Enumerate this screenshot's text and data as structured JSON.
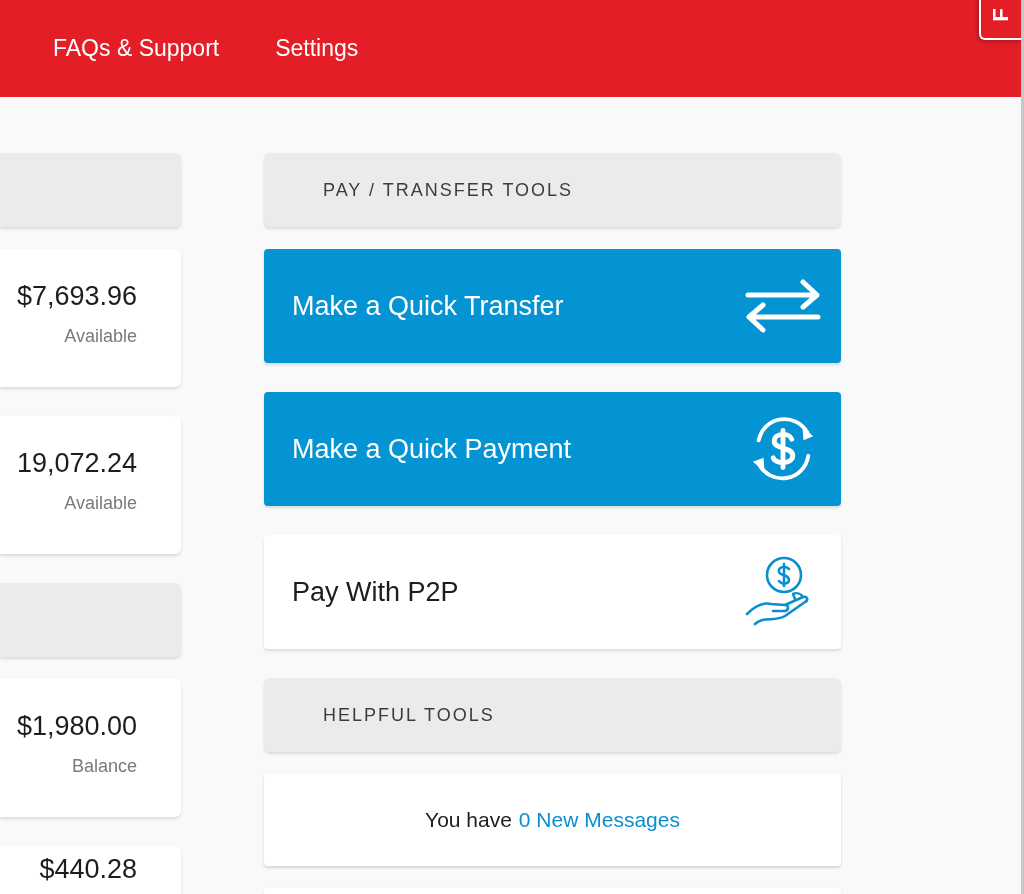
{
  "nav": {
    "items": [
      {
        "label": "FAQs & Support"
      },
      {
        "label": "Settings"
      }
    ]
  },
  "feedback_tab": {
    "label": "F"
  },
  "accounts": [
    {
      "kind": "header"
    },
    {
      "kind": "account",
      "amount": "$7,693.96",
      "caption": "Available"
    },
    {
      "kind": "account",
      "amount": "19,072.24",
      "caption": "Available"
    },
    {
      "kind": "header"
    },
    {
      "kind": "account",
      "amount": "$1,980.00",
      "caption": "Balance"
    },
    {
      "kind": "account",
      "amount": "$440.28"
    }
  ],
  "pay_tools": {
    "title": "PAY / TRANSFER TOOLS",
    "actions": [
      {
        "kind": "transfer",
        "label": "Make a Quick Transfer"
      },
      {
        "kind": "payment",
        "label": "Make a Quick Payment"
      },
      {
        "kind": "p2p",
        "label": "Pay With P2P"
      }
    ]
  },
  "helpful_tools": {
    "title": "HELPFUL TOOLS",
    "messages": {
      "prefix": "You have",
      "link": "0 New Messages"
    }
  }
}
